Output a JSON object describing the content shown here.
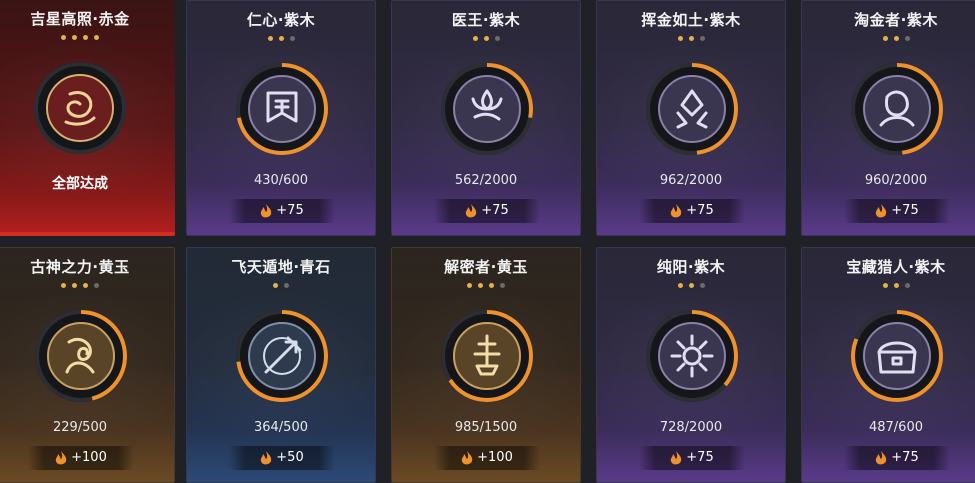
{
  "cards": [
    {
      "title": "吉星高照·赤金",
      "stars": 4,
      "max": 4,
      "theme": "red",
      "progress": 1.0,
      "status": "全部达成",
      "count": "",
      "reward": "",
      "emblem": "koi-emblem-icon"
    },
    {
      "title": "仁心·紫木",
      "stars": 2,
      "max": 3,
      "theme": "purple",
      "progress": 0.717,
      "status": "",
      "count": "430/600",
      "reward": "+75",
      "emblem": "banner-icon"
    },
    {
      "title": "医王·紫木",
      "stars": 2,
      "max": 3,
      "theme": "purple",
      "progress": 0.281,
      "status": "",
      "count": "562/2000",
      "reward": "+75",
      "emblem": "lotus-hand-icon"
    },
    {
      "title": "挥金如土·紫木",
      "stars": 2,
      "max": 3,
      "theme": "purple",
      "progress": 0.481,
      "status": "",
      "count": "962/2000",
      "reward": "+75",
      "emblem": "coin-pile-icon"
    },
    {
      "title": "淘金者·紫木",
      "stars": 2,
      "max": 3,
      "theme": "purple",
      "progress": 0.48,
      "status": "",
      "count": "960/2000",
      "reward": "+75",
      "emblem": "miner-icon"
    },
    {
      "title": "古神之力·黄玉",
      "stars": 3,
      "max": 4,
      "theme": "gold",
      "progress": 0.458,
      "status": "",
      "count": "229/500",
      "reward": "+100",
      "emblem": "beast-head-icon"
    },
    {
      "title": "飞天遁地·青石",
      "stars": 1,
      "max": 2,
      "theme": "blue",
      "progress": 0.728,
      "status": "",
      "count": "364/500",
      "reward": "+50",
      "emblem": "grapple-hook-icon"
    },
    {
      "title": "解密者·黄玉",
      "stars": 3,
      "max": 4,
      "theme": "gold",
      "progress": 0.657,
      "status": "",
      "count": "985/1500",
      "reward": "+100",
      "emblem": "relic-icon"
    },
    {
      "title": "纯阳·紫木",
      "stars": 2,
      "max": 3,
      "theme": "purple",
      "progress": 0.364,
      "status": "",
      "count": "728/2000",
      "reward": "+75",
      "emblem": "sun-icon"
    },
    {
      "title": "宝藏猎人·紫木",
      "stars": 2,
      "max": 3,
      "theme": "purple",
      "progress": 0.812,
      "status": "",
      "count": "487/600",
      "reward": "+75",
      "emblem": "treasure-chest-icon"
    }
  ],
  "colors": {
    "progress": "#f0922c",
    "star_on": "#e0b24a",
    "star_off": "#6b6b6b"
  }
}
